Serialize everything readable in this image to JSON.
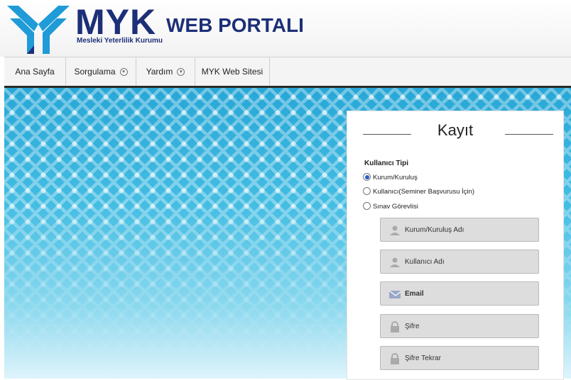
{
  "header": {
    "brand": "MYK",
    "brand_sub": "Mesleki Yeterlilik Kurumu",
    "portal": "WEB PORTALI",
    "logo_icon": "myk-logo-icon"
  },
  "nav": {
    "items": [
      {
        "label": "Ana Sayfa",
        "has_dropdown": false
      },
      {
        "label": "Sorgulama",
        "has_dropdown": true
      },
      {
        "label": "Yardım",
        "has_dropdown": true
      },
      {
        "label": "MYK Web Sitesi",
        "has_dropdown": false
      }
    ]
  },
  "form": {
    "title": "Kayıt",
    "user_type_label": "Kullanıcı Tipi",
    "user_types": [
      {
        "label": "Kurum/Kuruluş",
        "selected": true
      },
      {
        "label": "Kullanıcı(Seminer Başvurusu İçin)",
        "selected": false
      },
      {
        "label": "Sınav Görevlisi",
        "selected": false
      }
    ],
    "fields": [
      {
        "label": "Kurum/Kuruluş Adı",
        "icon": "user-icon"
      },
      {
        "label": "Kullanıcı Adı",
        "icon": "user-icon"
      },
      {
        "label": "Email",
        "icon": "envelope-icon"
      },
      {
        "label": "Şifre",
        "icon": "lock-icon"
      },
      {
        "label": "Şifre Tekrar",
        "icon": "lock-icon"
      }
    ]
  },
  "colors": {
    "brand_blue": "#1d2f78",
    "logo_cyan": "#1f9bd7",
    "hero_blue": "#27a7d6"
  }
}
